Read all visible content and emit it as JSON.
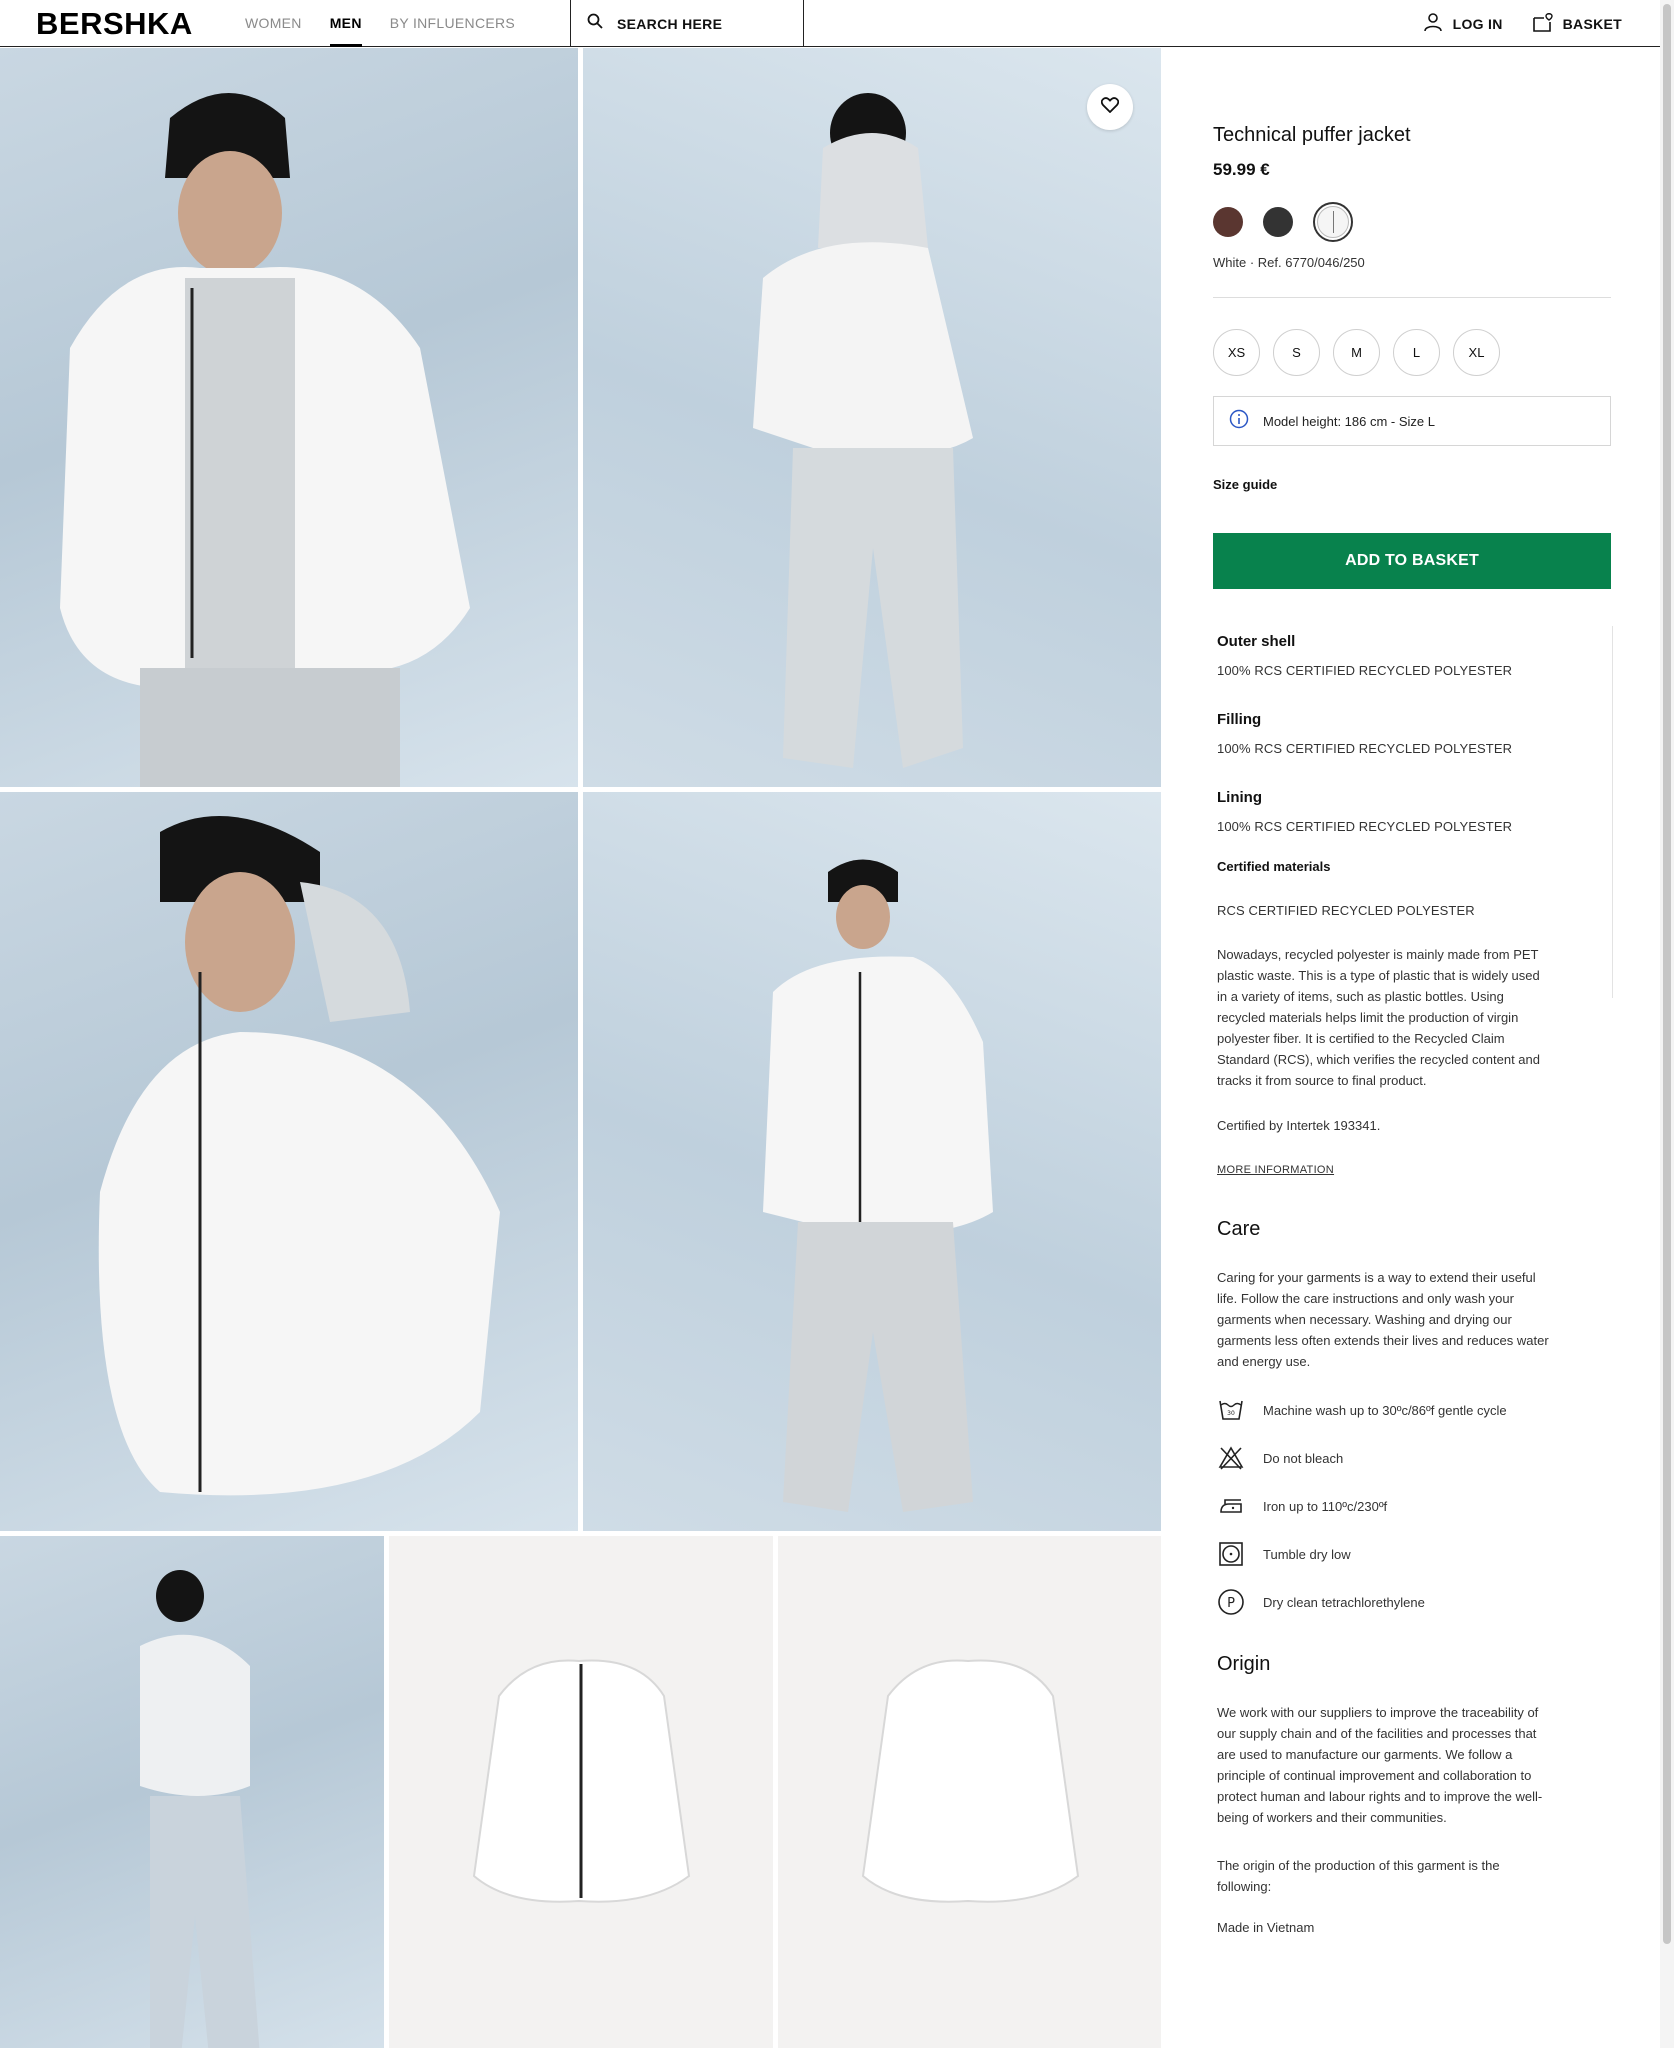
{
  "header": {
    "logo": "BERSHKA",
    "nav": [
      "WOMEN",
      "MEN",
      "BY INFLUENCERS"
    ],
    "search_label": "SEARCH HERE",
    "login_label": "LOG IN",
    "basket_label": "BASKET"
  },
  "product": {
    "title": "Technical puffer jacket",
    "price": "59.99 €",
    "colors": [
      {
        "name": "brown",
        "hex": "#5a3630"
      },
      {
        "name": "black",
        "hex": "#333333"
      },
      {
        "name": "white",
        "hex": "#f5f5f5",
        "selected": true
      }
    ],
    "color_ref": "White · Ref. 6770/046/250",
    "sizes": [
      "XS",
      "S",
      "M",
      "L",
      "XL"
    ],
    "model_info": "Model height: 186 cm - Size L",
    "size_guide": "Size guide",
    "add_to_basket": "ADD TO BASKET"
  },
  "materials": {
    "outer_shell_title": "Outer shell",
    "outer_shell_value": "100% RCS CERTIFIED RECYCLED POLYESTER",
    "filling_title": "Filling",
    "filling_value": "100% RCS CERTIFIED RECYCLED POLYESTER",
    "lining_title": "Lining",
    "lining_value": "100% RCS CERTIFIED RECYCLED POLYESTER",
    "certified_title": "Certified materials",
    "certified_name": "RCS CERTIFIED RECYCLED POLYESTER",
    "certified_desc_lines": [
      "Nowadays, recycled polyester is mainly made from PET",
      "plastic waste. This is a type of plastic that is widely used",
      "in a variety of items, such as plastic bottles. Using",
      "recycled materials helps limit the production of virgin",
      "polyester fiber. It is certified to the Recycled Claim",
      "Standard (RCS), which verifies the recycled content and",
      "tracks it from source to final product."
    ],
    "certified_by": "Certified by Intertek 193341.",
    "more_info": "MORE INFORMATION"
  },
  "care": {
    "title": "Care",
    "intro_lines": [
      "Caring for your garments is a way to extend their useful",
      "life. Follow the care instructions and only wash your",
      "garments when necessary. Washing and drying our",
      "garments less often extends their lives and reduces water",
      "and energy use."
    ],
    "items": [
      {
        "icon": "wash-30-icon",
        "text": "Machine wash up to 30ºc/86ºf gentle cycle"
      },
      {
        "icon": "no-bleach-icon",
        "text": "Do not bleach"
      },
      {
        "icon": "iron-icon",
        "text": "Iron up to 110ºc/230ºf"
      },
      {
        "icon": "tumble-dry-icon",
        "text": "Tumble dry low"
      },
      {
        "icon": "dry-clean-p-icon",
        "text": "Dry clean tetrachlorethylene"
      }
    ]
  },
  "origin": {
    "title": "Origin",
    "text_lines": [
      "We work with our suppliers to improve the traceability of",
      "our supply chain and of the facilities and processes that",
      "are used to manufacture our garments. We follow a",
      "principle of continual improvement and collaboration to",
      "protect human and labour rights and to improve the well-",
      "being of workers and their communities."
    ],
    "origin_lines": [
      "The origin of the production of this garment is the",
      "following:"
    ],
    "made_in": "Made in Vietnam"
  },
  "colors": {
    "accent_green": "#08824d",
    "photo_blue": "#c3d3df",
    "photo_white": "#f3f2f1"
  }
}
